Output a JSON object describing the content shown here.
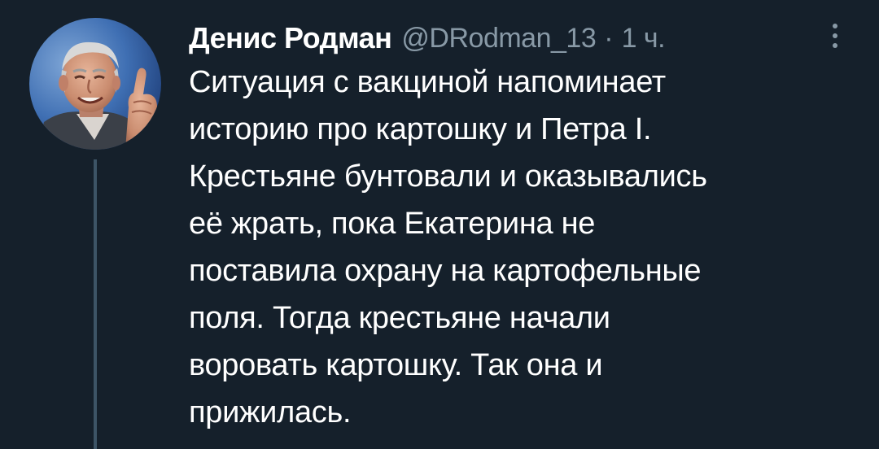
{
  "tweet": {
    "display_name": "Денис Родман",
    "handle": "@DRodman_13",
    "separator": "·",
    "time": "1 ч.",
    "text_lines": [
      "Ситуация с вакциной напоминает",
      "историю про картошку и Петра I.",
      "Крестьяне бунтовали и оказывались",
      "её жрать, пока Екатерина не",
      "поставила охрану на картофельные",
      "поля. Тогда крестьяне начали",
      "воровать картошку. Так она и",
      "прижилась."
    ]
  },
  "icons": {
    "avatar": "user-avatar",
    "more": "more-vertical-icon"
  },
  "colors": {
    "background": "#15202b",
    "text": "#ffffff",
    "secondary_text": "#8899a6",
    "thread_line": "#3d5466"
  }
}
